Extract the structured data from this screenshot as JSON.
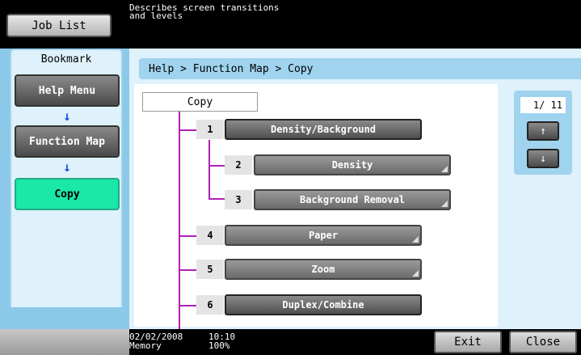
{
  "topbar": {
    "job_list_label": "Job List",
    "message_line1": "Describes screen transitions",
    "message_line2": "and levels"
  },
  "sidebar": {
    "tab_label": "Bookmark",
    "items": [
      {
        "label": "Help Menu"
      },
      {
        "label": "Function Map"
      },
      {
        "label": "Copy"
      }
    ],
    "arrow": "↓"
  },
  "breadcrumb": "Help > Function Map > Copy",
  "map": {
    "root_label": "Copy",
    "items": [
      {
        "num": "1",
        "label": "Density/Background"
      },
      {
        "num": "2",
        "label": "Density"
      },
      {
        "num": "3",
        "label": "Background Removal"
      },
      {
        "num": "4",
        "label": "Paper"
      },
      {
        "num": "5",
        "label": "Zoom"
      },
      {
        "num": "6",
        "label": "Duplex/Combine"
      }
    ]
  },
  "pager": {
    "page_text": "1/ 11",
    "up_icon": "↑",
    "down_icon": "↓"
  },
  "status": {
    "date": "02/02/2008",
    "time": "10:10",
    "memory_label": "Memory",
    "memory_value": "100%"
  },
  "bottom": {
    "exit_label": "Exit",
    "close_label": "Close"
  },
  "colors": {
    "accent_blue": "#8cc8e8",
    "tree_line": "#b21fb4",
    "active_green": "#19e8a6"
  }
}
